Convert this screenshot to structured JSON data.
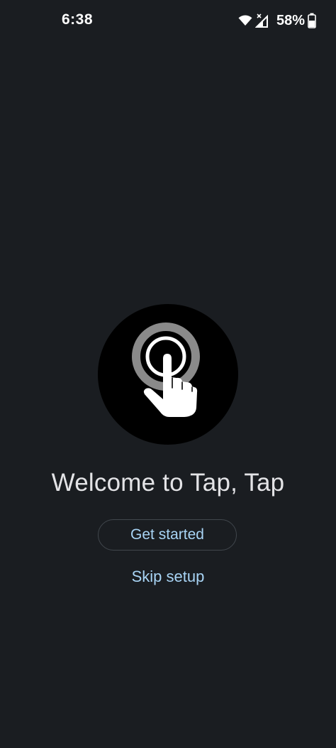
{
  "status_bar": {
    "time": "6:38",
    "battery_percent": "58%",
    "icons": [
      "wifi-icon",
      "cell-signal-icon",
      "battery-icon"
    ]
  },
  "welcome": {
    "hero_icon": "tap-gesture-icon",
    "title": "Welcome to Tap, Tap",
    "primary_button_label": "Get started",
    "secondary_link_label": "Skip setup"
  },
  "colors": {
    "background": "#1a1d21",
    "accent": "#a8d4f5",
    "title_text": "#e3e3e6"
  }
}
